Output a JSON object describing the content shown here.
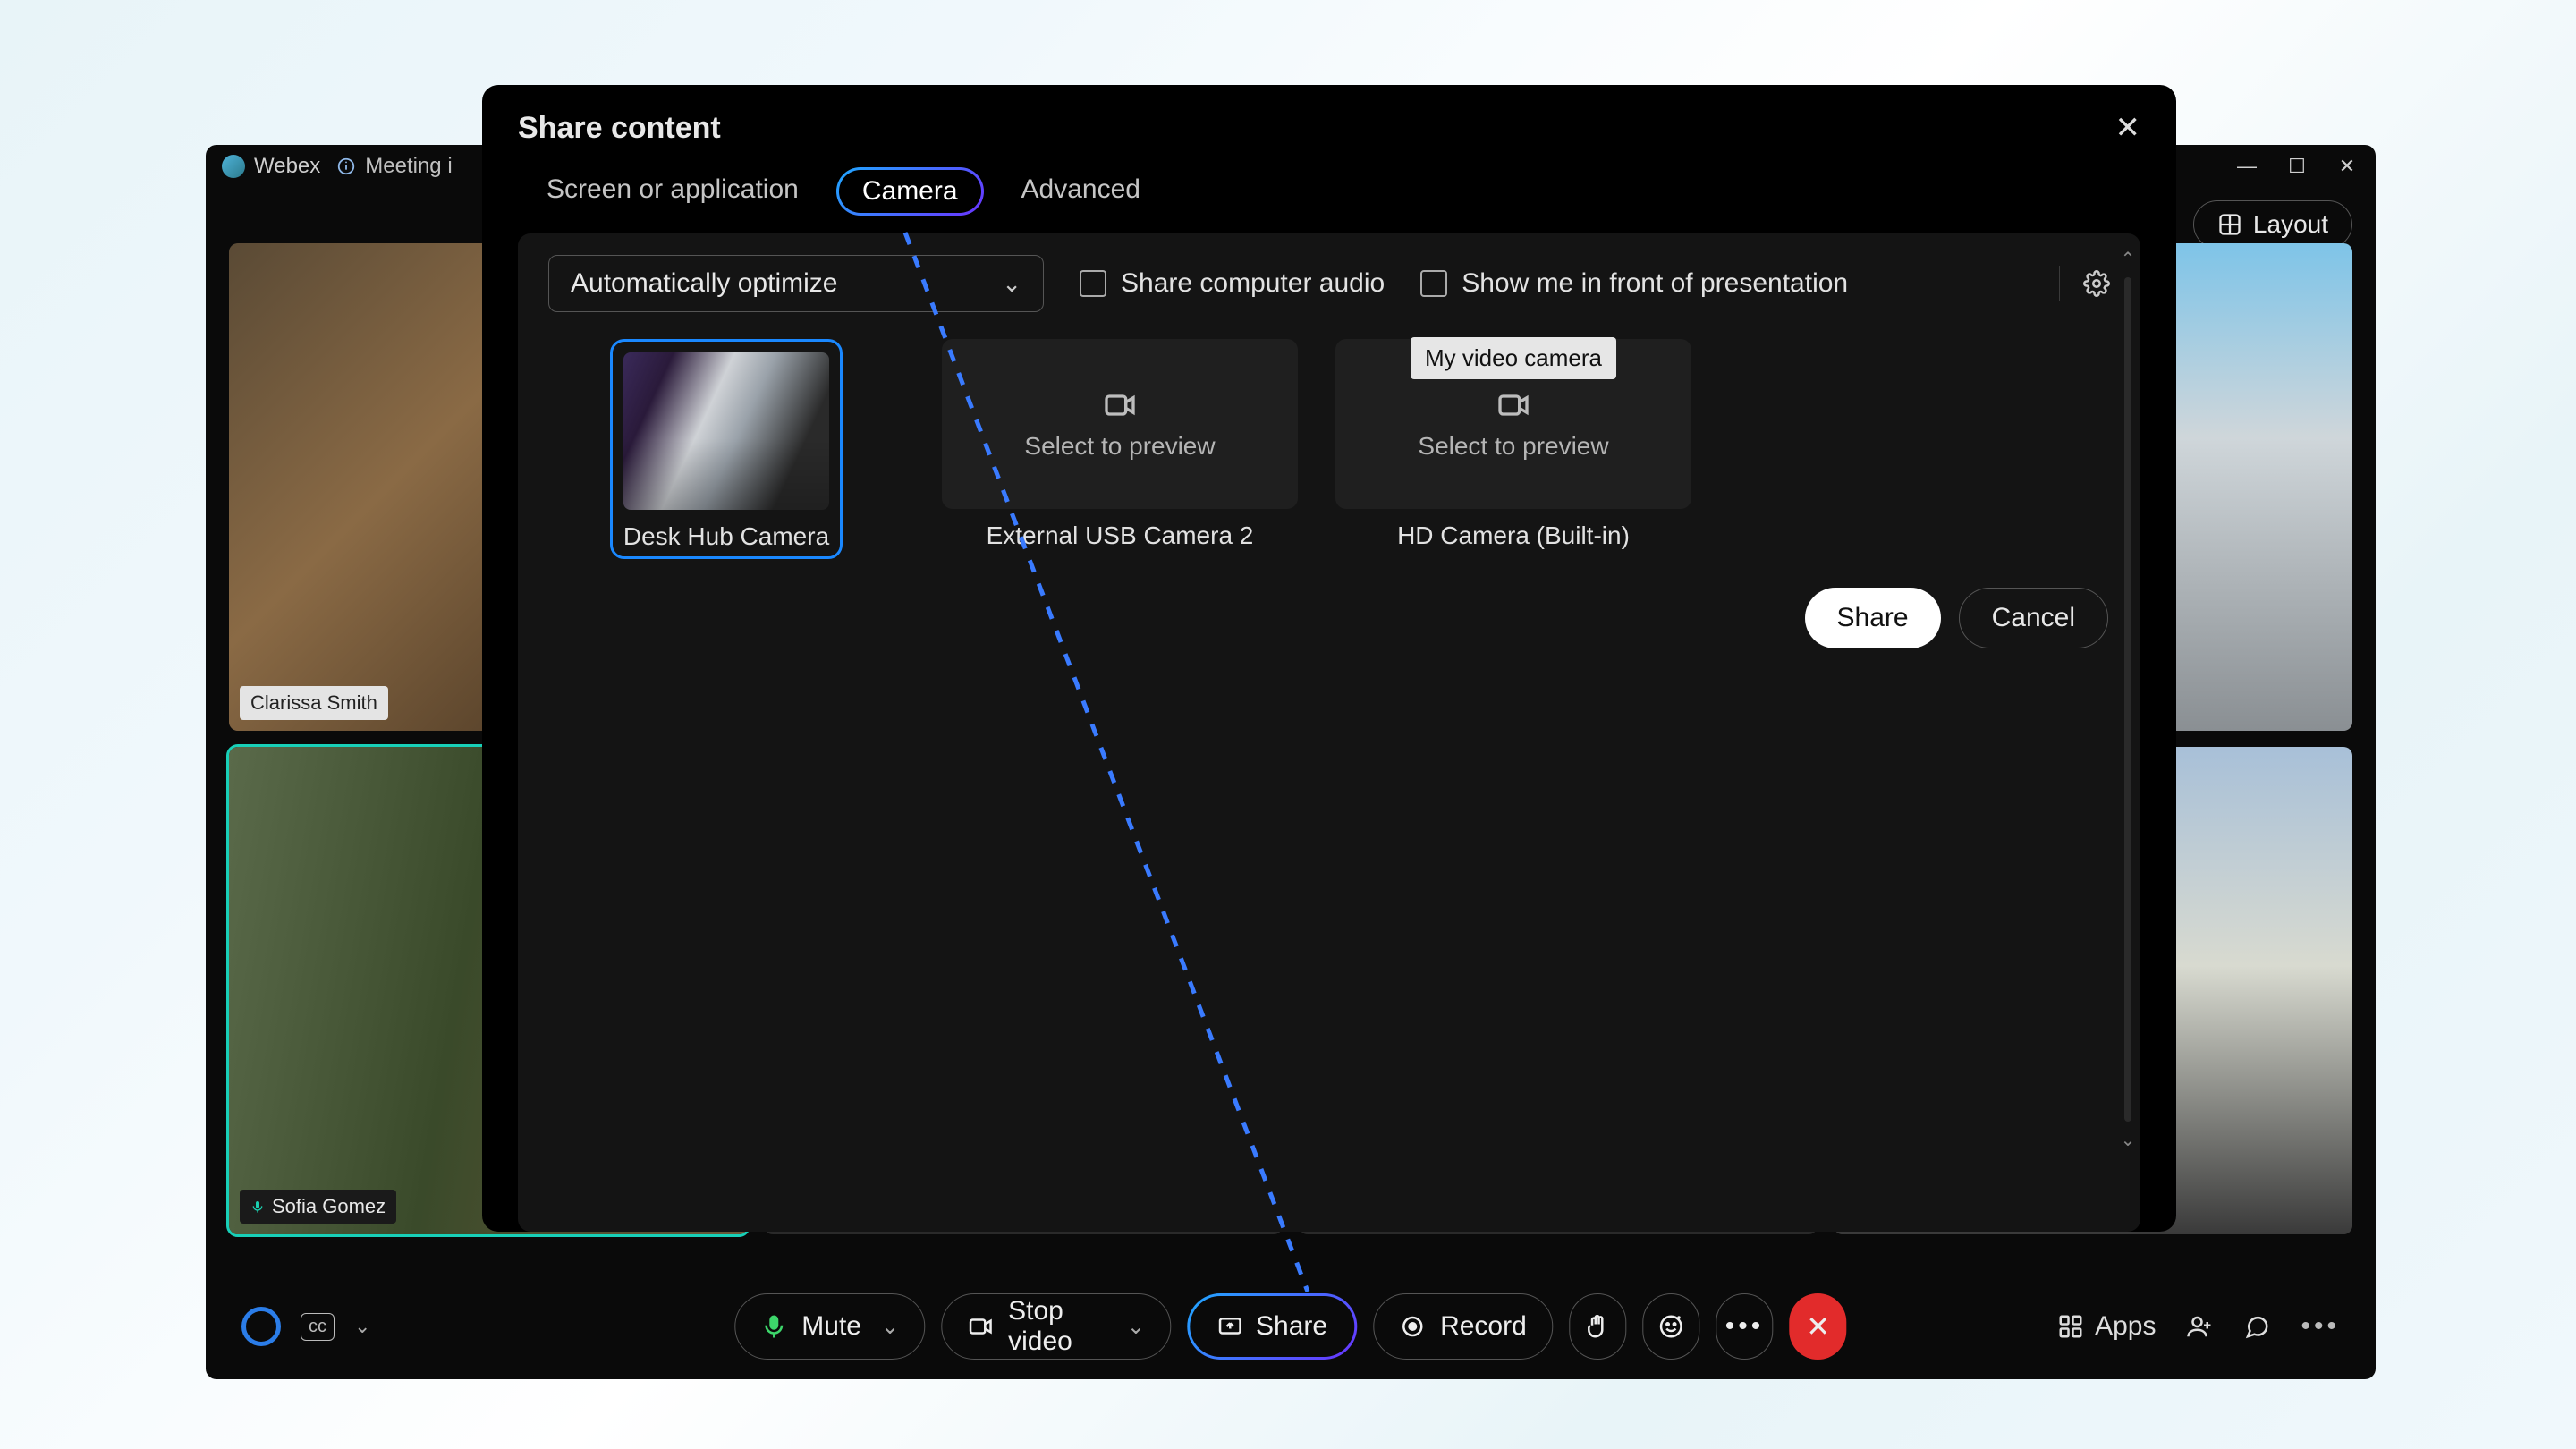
{
  "app": {
    "name": "Webex",
    "meeting_indicator": "Meeting i"
  },
  "layout_button": "Layout",
  "participants": {
    "p1": "Clarissa Smith",
    "p2": "Sofia Gomez"
  },
  "controls": {
    "mute": "Mute",
    "stop_video": "Stop video",
    "share": "Share",
    "record": "Record",
    "apps": "Apps"
  },
  "modal": {
    "title": "Share content",
    "tabs": {
      "screen": "Screen or application",
      "camera": "Camera",
      "advanced": "Advanced"
    },
    "optimize_label": "Automatically optimize",
    "share_audio_label": "Share computer audio",
    "show_me_label": "Show me in front of presentation",
    "tooltip": "My video camera",
    "select_preview": "Select to preview",
    "cameras": {
      "c1": "Desk Hub Camera",
      "c2": "External USB Camera 2",
      "c3": "HD Camera (Built-in)"
    },
    "share_btn": "Share",
    "cancel_btn": "Cancel"
  }
}
